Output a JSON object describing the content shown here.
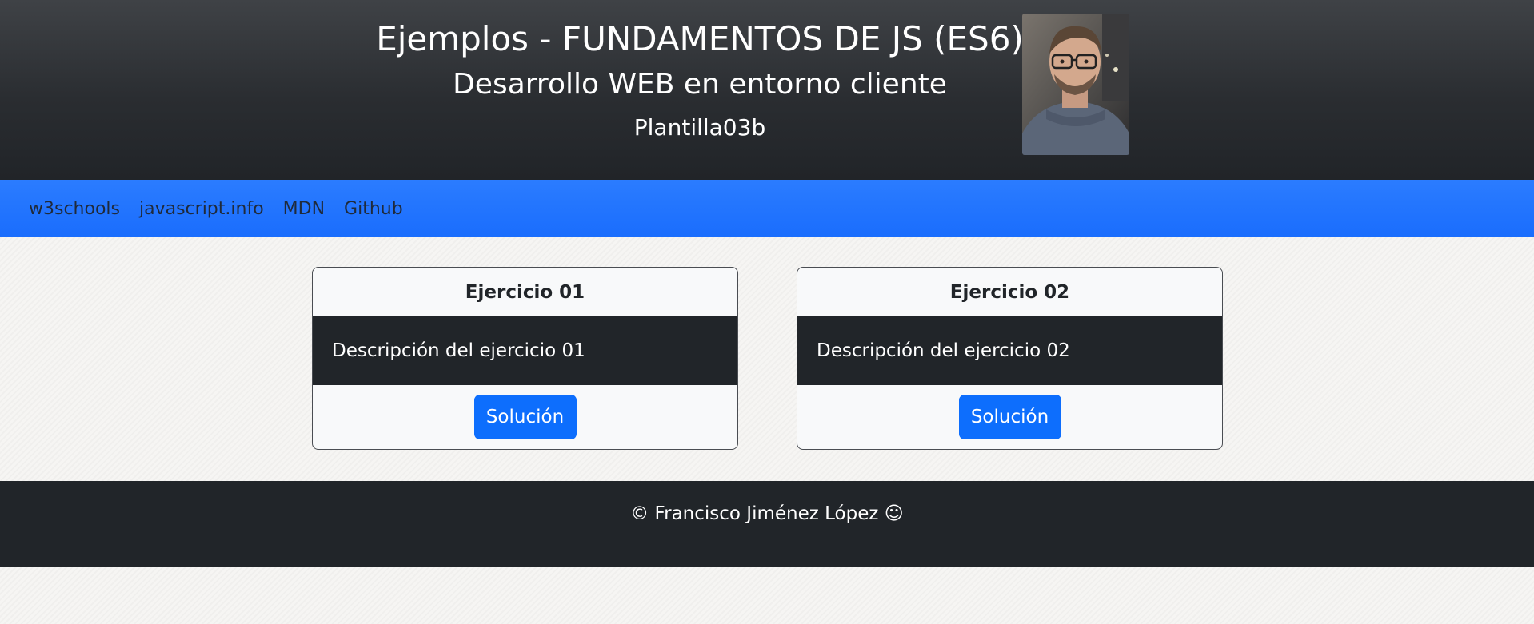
{
  "header": {
    "title": "Ejemplos - FUNDAMENTOS DE JS (ES6)",
    "subtitle": "Desarrollo WEB en entorno cliente",
    "template": "Plantilla03b"
  },
  "nav": {
    "links": [
      {
        "label": "w3schools"
      },
      {
        "label": "javascript.info"
      },
      {
        "label": "MDN"
      },
      {
        "label": "Github"
      }
    ]
  },
  "exercises": [
    {
      "title": "Ejercicio 01",
      "description": "Descripción del ejercicio 01",
      "button_label": "Solución"
    },
    {
      "title": "Ejercicio 02",
      "description": "Descripción del ejercicio 02",
      "button_label": "Solución"
    }
  ],
  "footer": {
    "text": "© Francisco Jiménez López ☺"
  },
  "colors": {
    "header_dark": "#212529",
    "nav_blue": "#2b7cff",
    "button_blue": "#0d6efd"
  }
}
